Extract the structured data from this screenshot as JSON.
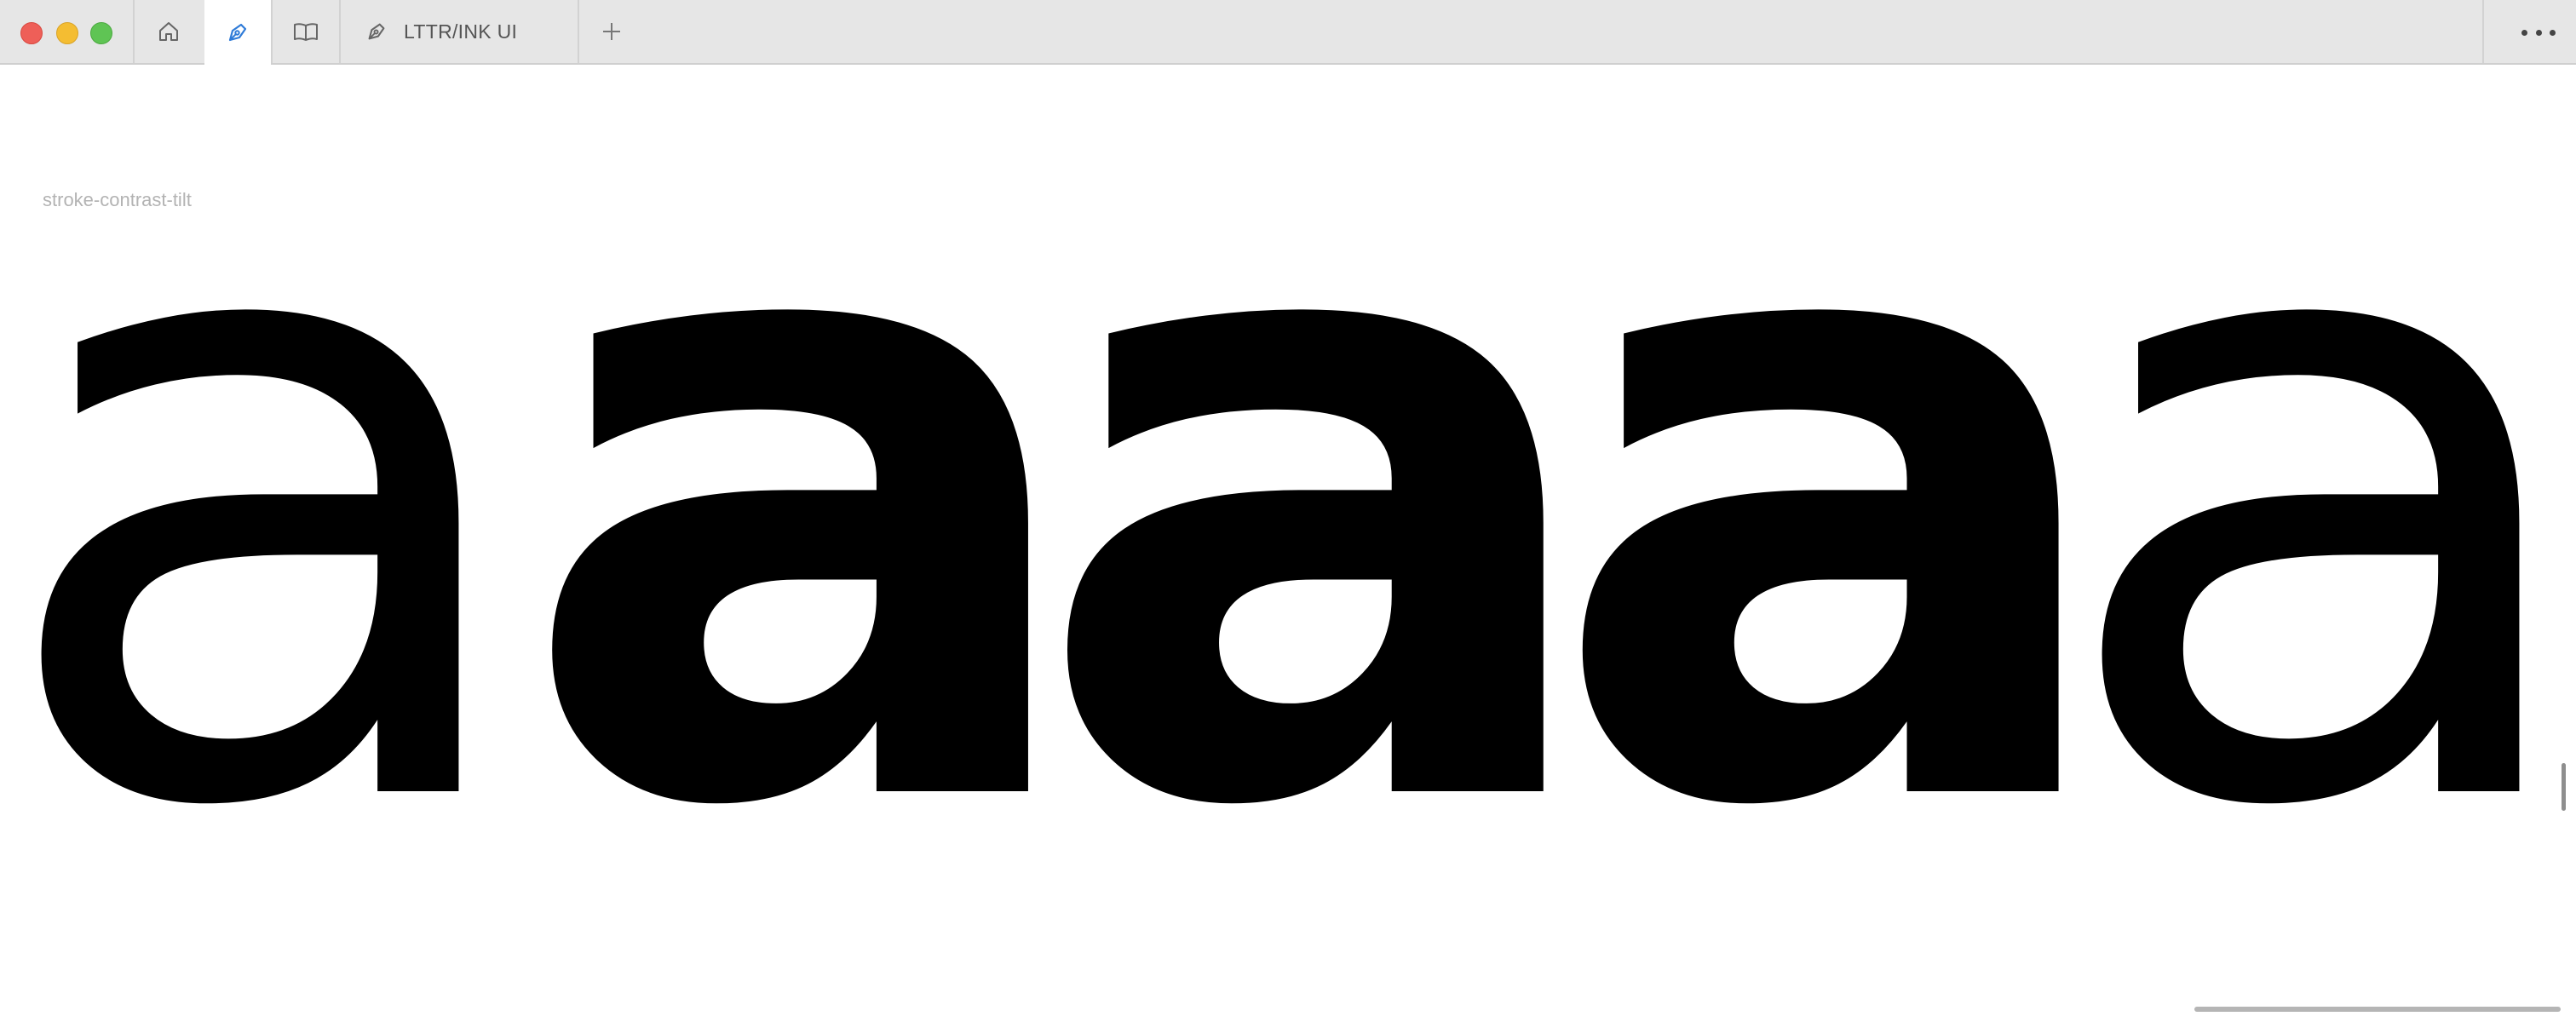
{
  "window": {
    "controls": [
      "close",
      "minimize",
      "zoom"
    ]
  },
  "tabs": [
    {
      "icon": "home-icon"
    },
    {
      "icon": "pen-nib-icon",
      "active": true,
      "accent": "#2f7bd8"
    },
    {
      "icon": "book-icon"
    },
    {
      "icon": "pen-nib-icon",
      "label": "LTTR/INK UI"
    }
  ],
  "toolbar": {
    "new_tab_icon": "plus-icon",
    "more_icon": "more-icon"
  },
  "canvas": {
    "caption": "stroke-contrast-tilt",
    "glyphs": [
      "a",
      "a",
      "a",
      "a",
      "a"
    ]
  }
}
